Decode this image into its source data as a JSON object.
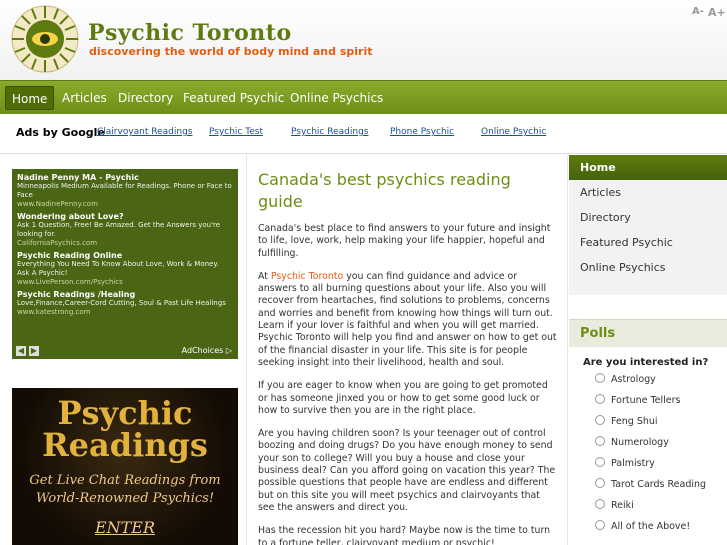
{
  "header": {
    "site_title": "Psychic Toronto",
    "tagline": "discovering the world of body mind and spirit",
    "font_smaller": "A-",
    "font_larger": "A+"
  },
  "nav": {
    "items": [
      "Home",
      "Articles",
      "Directory",
      "Featured Psychic",
      "Online Psychics"
    ],
    "active": "Home"
  },
  "ads_bar": {
    "label": "Ads by Google",
    "links": [
      "Clairvoyant Readings",
      "Psychic Test",
      "Psychic Readings",
      "Phone Psychic",
      "Online Psychic"
    ]
  },
  "ad_box": {
    "ads": [
      {
        "title": "Nadine Penny MA - Psychic",
        "text": "Minneapolis Medium Available for Readings. Phone or Face to Face",
        "url": "www.NadinePenny.com"
      },
      {
        "title": "Wondering about Love?",
        "text": "Ask 1 Question, Free! Be Amazed. Get the Answers you're looking for.",
        "url": "CaliforniaPsychics.com"
      },
      {
        "title": "Psychic Reading Online",
        "text": "Everything You Need To Know About Love, Work & Money. Ask A Psychic!",
        "url": "www.LivePerson.com/Psychics"
      },
      {
        "title": "Psychic Readings /Healing",
        "text": "Love,Finance,Career-Cord Cutting, Soul & Past Life Healings",
        "url": "www.katestrong.com"
      }
    ],
    "prev": "◀",
    "next": "▶",
    "adchoices": "AdChoices ▷"
  },
  "banner": {
    "line1": "Psychic",
    "line2": "Readings",
    "sub": "Get Live Chat Readings from World-Renowned Psychics!",
    "enter": "ENTER"
  },
  "main": {
    "heading": "Canada's best psychics reading guide",
    "p1": "Canada's best place to find answers to your future and insight to life, love, work, help making your life happier, hopeful and fulfilling.",
    "p2_before": "At ",
    "p2_link": "Psychic Toronto",
    "p2_after": " you can find guidance and advice or answers to all burning questions about your life. Also you will recover from heartaches, find solutions to problems, concerns and worries and benefit from knowing how things will turn out. Learn if your lover is faithful and when you will get married. Psychic Toronto will help you find and answer on how to get out of the financial disaster in your life.  This site is for people seeking insight into their livelihood, health and soul.",
    "p3": "If you are eager to know when you are going to get promoted or has someone jinxed you or how to get some good luck or how to survive then you are in the right place.",
    "p4": "Are you having children soon? Is your teenager out of control boozing and doing drugs? Do you have enough money to send your son to college? Will you buy a house and close your business deal? Can you afford going on vacation this year? The possible questions that people have are endless and different but on this site you will meet psychics and clairvoyants that see the answers and direct you.",
    "p5": "Has the recession hit you hard? Maybe now is the time to turn to a fortune teller, clairvoyant medium or psychic!"
  },
  "side_nav": {
    "items": [
      "Home",
      "Articles",
      "Directory",
      "Featured Psychic",
      "Online Psychics"
    ],
    "active": "Home"
  },
  "polls": {
    "heading": "Polls",
    "question": "Are you interested in?",
    "options": [
      "Astrology",
      "Fortune Tellers",
      "Feng Shui",
      "Numerology",
      "Palmistry",
      "Tarot Cards Reading",
      "Reiki",
      "All of the Above!"
    ]
  },
  "colors": {
    "brand_green": "#6b8e14",
    "accent_orange": "#e25c12",
    "nav_dark": "#4f6c06"
  }
}
